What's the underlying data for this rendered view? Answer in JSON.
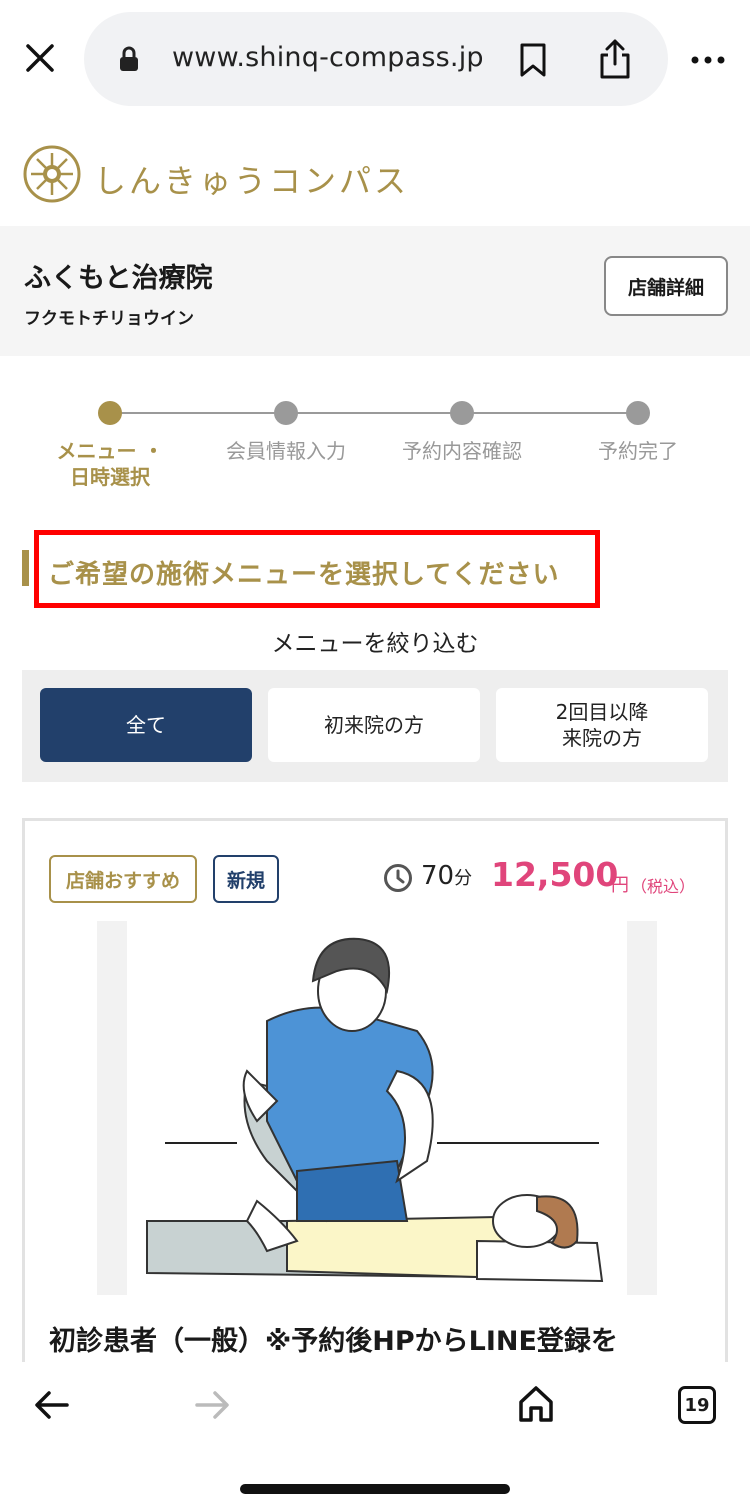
{
  "browser": {
    "url": "www.shinq-compass.jp",
    "tab_count": "19"
  },
  "site": {
    "logo_text": "しんきゅうコンパス",
    "brand_color": "#a8914a"
  },
  "shop": {
    "name": "ふくもと治療院",
    "kana": "フクモトチリョウイン",
    "detail_button": "店舗詳細"
  },
  "steps": [
    {
      "label": "メニュー ・\n日時選択",
      "active": true
    },
    {
      "label": "会員情報入力",
      "active": false
    },
    {
      "label": "予約内容確認",
      "active": false
    },
    {
      "label": "予約完了",
      "active": false
    }
  ],
  "section": {
    "heading": "ご希望の施術メニューを選択してください",
    "filter_title": "メニューを絞り込む"
  },
  "filters": [
    {
      "label": "全て",
      "active": true
    },
    {
      "label": "初来院の方",
      "active": false
    },
    {
      "label": "2回目以降\n来院の方",
      "active": false
    }
  ],
  "menu_card": {
    "tags": [
      "店舗おすすめ",
      "新規"
    ],
    "duration_value": "70",
    "duration_unit": "分",
    "price": "12,500",
    "price_unit": "円",
    "price_tax": "（税込）",
    "title": "初診患者（一般）※予約後HPからLINE登録を"
  },
  "colors": {
    "accent_gold": "#a8914a",
    "navy": "#22406b",
    "price_pink": "#e0457b",
    "highlight_red": "#ff0000"
  }
}
